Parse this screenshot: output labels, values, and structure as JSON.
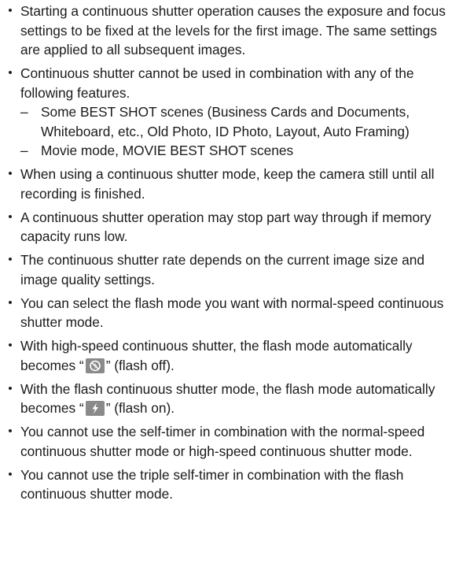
{
  "items": [
    {
      "text": "Starting a continuous shutter operation causes the exposure and focus settings to be fixed at the levels for the first image. The same settings are applied to all subsequent images."
    },
    {
      "text": "Continuous shutter cannot be used in combination with any of the following features.",
      "subitems": [
        "Some BEST SHOT scenes (Business Cards and Documents, Whiteboard, etc., Old Photo, ID Photo, Layout, Auto Framing)",
        "Movie mode, MOVIE BEST SHOT scenes"
      ]
    },
    {
      "text": "When using a continuous shutter mode, keep the camera still until all recording is finished."
    },
    {
      "text": "A continuous shutter operation may stop part way through if memory capacity runs low."
    },
    {
      "text": "The continuous shutter rate depends on the current image size and image quality settings."
    },
    {
      "text": "You can select the flash mode you want with normal-speed continuous shutter mode."
    },
    {
      "before": "With high-speed continuous shutter, the flash mode automatically becomes “",
      "icon": "flash-off-icon",
      "after": "” (flash off)."
    },
    {
      "before": "With the flash continuous shutter mode, the flash mode automatically becomes “",
      "icon": "flash-on-icon",
      "after": "” (flash on)."
    },
    {
      "text": "You cannot use the self-timer in combination with the normal-speed continuous shutter mode or high-speed continuous shutter mode."
    },
    {
      "text": "You cannot use the triple self-timer in combination with the flash continuous shutter mode."
    }
  ],
  "bullet_glyph": "•",
  "dash_glyph": "–",
  "icon_color": "#8a8a8a"
}
